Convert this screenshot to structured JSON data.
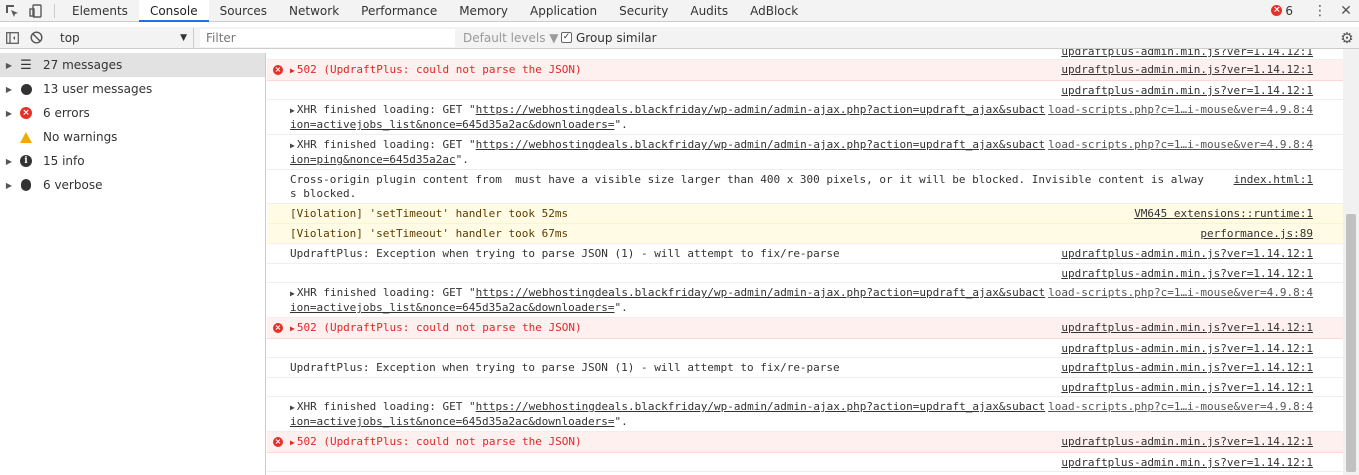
{
  "tabs": [
    {
      "label": "Elements"
    },
    {
      "label": "Console"
    },
    {
      "label": "Sources"
    },
    {
      "label": "Network"
    },
    {
      "label": "Performance"
    },
    {
      "label": "Memory"
    },
    {
      "label": "Application"
    },
    {
      "label": "Security"
    },
    {
      "label": "Audits"
    },
    {
      "label": "AdBlock"
    }
  ],
  "header": {
    "error_count": "6"
  },
  "filterbar": {
    "context": "top",
    "filter_placeholder": "Filter",
    "levels_label": "Default levels ▼",
    "group_similar_label": "Group similar",
    "group_similar_checked": "✓"
  },
  "sidebar": {
    "items": [
      {
        "label": "27 messages",
        "icon": "list-icon"
      },
      {
        "label": "13 user messages",
        "icon": "user-icon"
      },
      {
        "label": "6 errors",
        "icon": "error-icon"
      },
      {
        "label": "No warnings",
        "icon": "warning-icon"
      },
      {
        "label": "15 info",
        "icon": "info-icon"
      },
      {
        "label": "6 verbose",
        "icon": "bug-icon"
      }
    ]
  },
  "console": {
    "top_clipped_src": "updraftplus-admin.min.js?ver=1.14.12:1",
    "rows": [
      {
        "msg": "502 (UpdraftPlus: could not parse the JSON)",
        "src": "updraftplus-admin.min.js?ver=1.14.12:1"
      },
      {
        "msg": "",
        "src": "updraftplus-admin.min.js?ver=1.14.12:1"
      },
      {
        "prefix": "XHR finished loading: GET \"",
        "link": "https://webhostingdeals.blackfriday/wp-admin/admin-ajax.php?action=updraft_ajax&subaction=activejobs_list&nonce=645d35a2ac&downloaders=",
        "suffix": "\".",
        "src": "load-scripts.php?c=1…i-mouse&ver=4.9.8:4"
      },
      {
        "prefix": "XHR finished loading: GET \"",
        "link": "https://webhostingdeals.blackfriday/wp-admin/admin-ajax.php?action=updraft_ajax&subaction=ping&nonce=645d35a2ac",
        "suffix": "\".",
        "src": "load-scripts.php?c=1…i-mouse&ver=4.9.8:4"
      },
      {
        "msg": "Cross-origin plugin content from  must have a visible size larger than 400 x 300 pixels, or it will be blocked. Invisible content is always blocked.",
        "src": "index.html:1"
      },
      {
        "msg": "[Violation] 'setTimeout' handler took 52ms",
        "src": "VM645 extensions::runtime:1"
      },
      {
        "msg": "[Violation] 'setTimeout' handler took 67ms",
        "src": "performance.js:89"
      },
      {
        "msg": "UpdraftPlus: Exception when trying to parse JSON (1) - will attempt to fix/re-parse",
        "src": "updraftplus-admin.min.js?ver=1.14.12:1"
      },
      {
        "msg": "",
        "src": "updraftplus-admin.min.js?ver=1.14.12:1"
      },
      {
        "prefix": "XHR finished loading: GET \"",
        "link": "https://webhostingdeals.blackfriday/wp-admin/admin-ajax.php?action=updraft_ajax&subaction=activejobs_list&nonce=645d35a2ac&downloaders=",
        "suffix": "\".",
        "src": "load-scripts.php?c=1…i-mouse&ver=4.9.8:4"
      },
      {
        "msg": "502 (UpdraftPlus: could not parse the JSON)",
        "src": "updraftplus-admin.min.js?ver=1.14.12:1"
      },
      {
        "msg": "",
        "src": "updraftplus-admin.min.js?ver=1.14.12:1"
      },
      {
        "msg": "UpdraftPlus: Exception when trying to parse JSON (1) - will attempt to fix/re-parse",
        "src": "updraftplus-admin.min.js?ver=1.14.12:1"
      },
      {
        "msg": "",
        "src": "updraftplus-admin.min.js?ver=1.14.12:1"
      },
      {
        "prefix": "XHR finished loading: GET \"",
        "link": "https://webhostingdeals.blackfriday/wp-admin/admin-ajax.php?action=updraft_ajax&subaction=activejobs_list&nonce=645d35a2ac&downloaders=",
        "suffix": "\".",
        "src": "load-scripts.php?c=1…i-mouse&ver=4.9.8:4"
      },
      {
        "msg": "502 (UpdraftPlus: could not parse the JSON)",
        "src": "updraftplus-admin.min.js?ver=1.14.12:1"
      },
      {
        "msg": "",
        "src": "updraftplus-admin.min.js?ver=1.14.12:1"
      }
    ],
    "prompt": "›"
  },
  "colors": {
    "error": "#e5302a",
    "warning": "#f2a900",
    "accent": "#1a73e8"
  }
}
